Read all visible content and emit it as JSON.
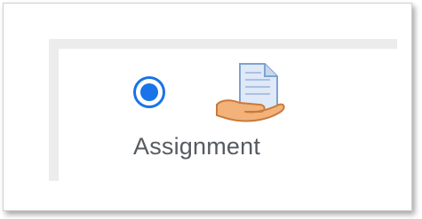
{
  "activity_chooser": {
    "selected": true,
    "option": {
      "label": "Assignment",
      "icon": "assignment-icon"
    }
  },
  "colors": {
    "radio_accent": "#1a73e8",
    "label_text": "#555b61",
    "panel_border": "#ececec"
  }
}
